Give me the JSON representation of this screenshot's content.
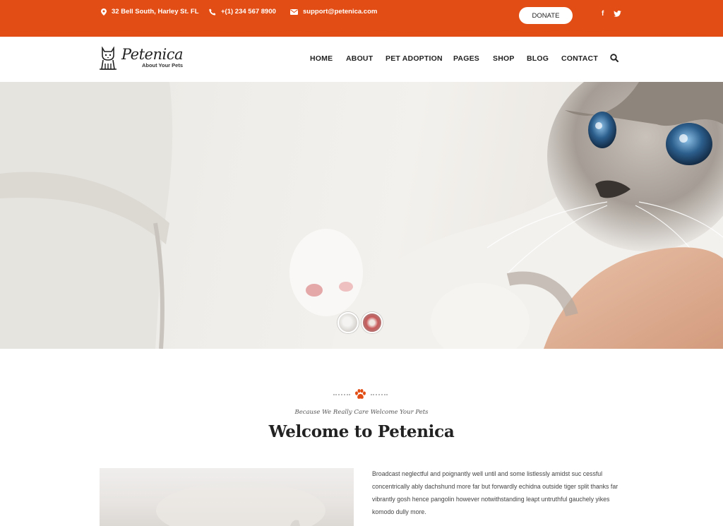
{
  "topbar": {
    "address": "32 Bell South, Harley St. FL",
    "phone": "+(1) 234 567 8900",
    "email": "support@petenica.com",
    "donate_label": "DONATE",
    "facebook": "f",
    "accent_color": "#e14d14"
  },
  "header": {
    "logo_name": "Petenica",
    "logo_tagline": "About Your Pets",
    "nav": [
      "HOME",
      "ABOUT",
      "PET ADOPTION",
      "PAGES",
      "SHOP",
      "BLOG",
      "CONTACT"
    ]
  },
  "welcome": {
    "subtitle": "Because We Really Care Welcome Your Pets",
    "title": "Welcome to Petenica",
    "paragraph": "Broadcast neglectful and poignantly well until and some listlessly amidst suc cessful concentrically ably dachshund more far but forwardly echidna outside tiger split thanks far vibrantly gosh hence pangolin however notwithstanding leapt untruthful gauchely yikes komodo dully more."
  }
}
